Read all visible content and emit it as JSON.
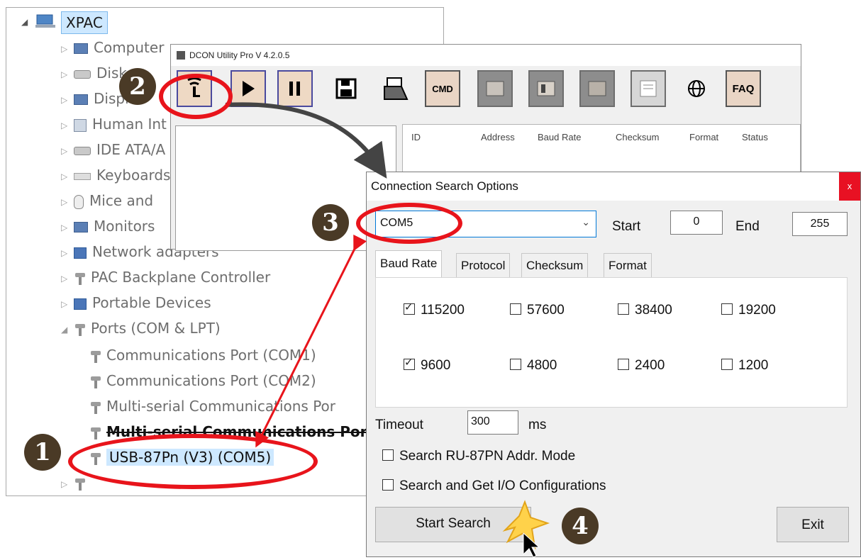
{
  "device_manager": {
    "root_label": "XPAC",
    "items": [
      {
        "label": "Computer",
        "icon": "computer-icon"
      },
      {
        "label": "Disk",
        "icon": "disk-drive-icon"
      },
      {
        "label": "Displ",
        "icon": "display-adapter-icon"
      },
      {
        "label": "Human Int",
        "icon": "human-interface-icon"
      },
      {
        "label": "IDE ATA/A",
        "icon": "ide-controller-icon"
      },
      {
        "label": "Keyboards",
        "icon": "keyboard-icon"
      },
      {
        "label": "Mice and",
        "icon": "mouse-icon"
      },
      {
        "label": "Monitors",
        "icon": "monitor-icon"
      },
      {
        "label": "Network adapters",
        "icon": "network-adapter-icon"
      },
      {
        "label": "PAC Backplane Controller",
        "icon": "port-plug-icon"
      },
      {
        "label": "Portable Devices",
        "icon": "portable-device-icon"
      },
      {
        "label": "Ports (COM & LPT)",
        "icon": "port-plug-icon"
      }
    ],
    "ports": [
      "Communications Port (COM1)",
      "Communications Port (COM2)",
      "Multi-serial Communications Por",
      "Multi-serial Communications Por",
      "USB-87Pn (V3) (COM5)"
    ]
  },
  "dcon": {
    "title": "DCON Utility Pro  V 4.2.0.5",
    "toolbar": [
      {
        "name": "search-button",
        "icon": "antenna-icon"
      },
      {
        "name": "start-button",
        "icon": "play-icon"
      },
      {
        "name": "pause-button",
        "icon": "pause-icon"
      },
      {
        "name": "save-button",
        "icon": "floppy-icon"
      },
      {
        "name": "open-button",
        "icon": "folder-icon"
      },
      {
        "name": "cmd-button",
        "label": "CMD"
      },
      {
        "name": "tool-button-1",
        "icon": "module-icon"
      },
      {
        "name": "tool-button-2",
        "icon": "module-icon"
      },
      {
        "name": "tool-button-3",
        "icon": "module-icon"
      },
      {
        "name": "tool-button-4",
        "icon": "window-icon"
      },
      {
        "name": "web-button",
        "icon": "globe-icon"
      },
      {
        "name": "faq-button",
        "label": "FAQ"
      }
    ],
    "columns": [
      "ID",
      "Address",
      "Baud Rate",
      "Checksum",
      "Format",
      "Status"
    ]
  },
  "dialog": {
    "title": "Connection Search Options",
    "close": "x",
    "com_port": "COM5",
    "start_label": "Start",
    "start_value": "0",
    "end_label": "End",
    "end_value": "255",
    "tabs": [
      "Baud Rate",
      "Protocol",
      "Checksum",
      "Format"
    ],
    "baud_rates": [
      {
        "label": "115200",
        "checked": true
      },
      {
        "label": "57600",
        "checked": false
      },
      {
        "label": "38400",
        "checked": false
      },
      {
        "label": "19200",
        "checked": false
      },
      {
        "label": "9600",
        "checked": true
      },
      {
        "label": "4800",
        "checked": false
      },
      {
        "label": "2400",
        "checked": false
      },
      {
        "label": "1200",
        "checked": false
      }
    ],
    "timeout_label": "Timeout",
    "timeout_value": "300",
    "timeout_unit": "ms",
    "option_ru87pn": "Search RU-87PN Addr. Mode",
    "option_io": "Search and Get I/O Configurations",
    "start_search": "Start Search",
    "exit": "Exit"
  },
  "callouts": [
    "1",
    "2",
    "3",
    "4"
  ],
  "colors": {
    "highlight": "#e8141b",
    "badge": "#4a3a26",
    "selection": "#cde8ff"
  }
}
